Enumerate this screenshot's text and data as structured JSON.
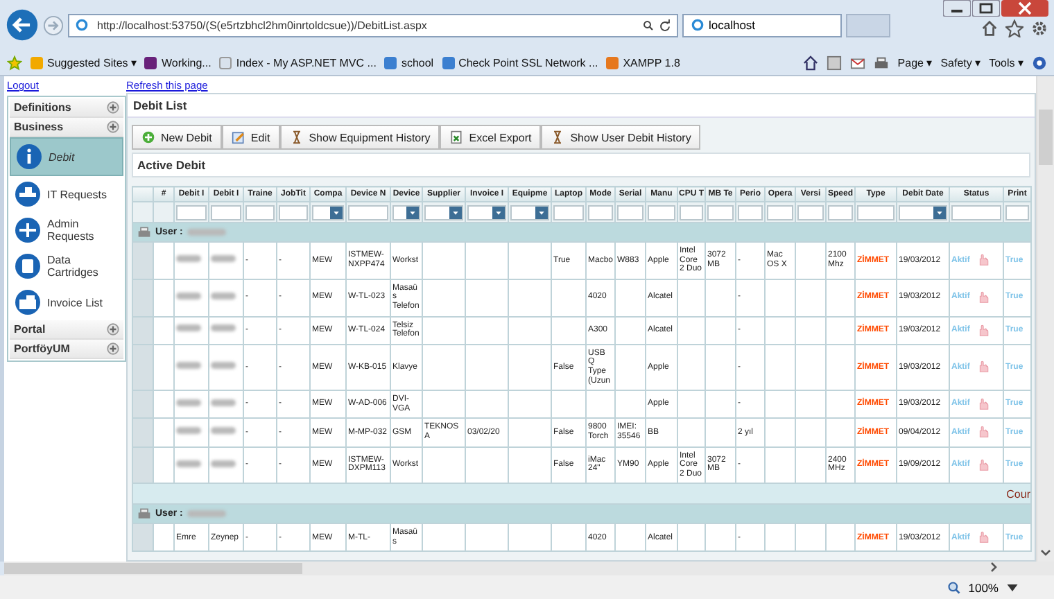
{
  "browser": {
    "address": "http://localhost:53750/(S(e5rtzbhcl2hm0inrtoldcsue))/DebitList.aspx",
    "tabs": [
      {
        "label": "localhost",
        "selected": true
      }
    ],
    "favorites": [
      "Suggested Sites ▾",
      "Working...",
      "Index - My ASP.NET MVC ...",
      "school",
      "Check Point SSL Network ...",
      "XAMPP 1.8"
    ],
    "commands": [
      "Page ▾",
      "Safety ▾",
      "Tools ▾"
    ],
    "zoom": "100%"
  },
  "page": {
    "logout": "Logout",
    "refresh": "Refresh this page",
    "title": "Debit List",
    "subtitle": "Active Debit",
    "sidebar": [
      {
        "label": "Definitions"
      },
      {
        "label": "Business",
        "items": [
          {
            "label": "Debit",
            "selected": true
          },
          {
            "label": "IT Requests",
            "selected": false
          },
          {
            "label": "Admin Requests",
            "selected": false
          },
          {
            "label": "Data Cartridges",
            "selected": false
          },
          {
            "label": "Invoice List",
            "selected": false
          }
        ]
      },
      {
        "label": "Portal"
      },
      {
        "label": "PortföyUM"
      }
    ],
    "toolbar": [
      "New Debit",
      "Edit",
      "Show Equipment History",
      "Excel Export",
      "Show User Debit History"
    ]
  },
  "table": {
    "columns": [
      {
        "label": "#",
        "filterable": false,
        "kind": "plain"
      },
      {
        "label": "Debit I",
        "filterable": true,
        "dropdown": false,
        "kind": "plain"
      },
      {
        "label": "Debit I",
        "filterable": true,
        "dropdown": false,
        "kind": "plain"
      },
      {
        "label": "Traine",
        "filterable": true,
        "dropdown": false,
        "kind": "plain"
      },
      {
        "label": "JobTit",
        "filterable": true,
        "dropdown": false,
        "kind": "plain"
      },
      {
        "label": "Compa",
        "filterable": true,
        "dropdown": true,
        "kind": "plain"
      },
      {
        "label": "Device N",
        "filterable": true,
        "dropdown": false,
        "kind": "plain"
      },
      {
        "label": "Device",
        "filterable": true,
        "dropdown": true,
        "kind": "plain"
      },
      {
        "label": "Supplier",
        "filterable": true,
        "dropdown": true,
        "kind": "plain"
      },
      {
        "label": "Invoice I",
        "filterable": true,
        "dropdown": true,
        "kind": "plain"
      },
      {
        "label": "Equipme",
        "filterable": true,
        "dropdown": true,
        "kind": "plain"
      },
      {
        "label": "Laptop",
        "filterable": true,
        "dropdown": false,
        "kind": "plain"
      },
      {
        "label": "Mode",
        "filterable": true,
        "dropdown": false,
        "kind": "plain"
      },
      {
        "label": "Serial",
        "filterable": true,
        "dropdown": false,
        "kind": "plain"
      },
      {
        "label": "Manu",
        "filterable": true,
        "dropdown": false,
        "kind": "plain"
      },
      {
        "label": "CPU T",
        "filterable": true,
        "dropdown": false,
        "kind": "plain"
      },
      {
        "label": "MB Te",
        "filterable": true,
        "dropdown": false,
        "kind": "plain"
      },
      {
        "label": "Perio",
        "filterable": true,
        "dropdown": false,
        "kind": "plain"
      },
      {
        "label": "Opera",
        "filterable": true,
        "dropdown": false,
        "kind": "plain"
      },
      {
        "label": "Versi",
        "filterable": true,
        "dropdown": false,
        "kind": "plain"
      },
      {
        "label": "Speed",
        "filterable": true,
        "dropdown": false,
        "kind": "plain"
      },
      {
        "label": "Type",
        "filterable": true,
        "dropdown": false,
        "kind": "type"
      },
      {
        "label": "Debit Date",
        "filterable": true,
        "dropdown": true,
        "kind": "plain"
      },
      {
        "label": "Status",
        "filterable": true,
        "dropdown": false,
        "kind": "status"
      },
      {
        "label": "Print",
        "filterable": true,
        "dropdown": false,
        "kind": "link"
      }
    ],
    "groups": [
      {
        "label": "User :",
        "footer": "Cour",
        "rows": [
          {
            "cells": [
              null,
              {
                "kind": "blurred"
              },
              {
                "kind": "blurred"
              },
              "-",
              "-",
              "MEW",
              "ISTMEW-NXPP474",
              "Workst",
              null,
              null,
              null,
              "True",
              "Macbo",
              "W883",
              "Apple",
              "Intel Core 2 Duo",
              "3072 MB",
              "-",
              "Mac OS X",
              null,
              "2100 Mhz",
              "ZİMMET",
              "19/03/2012",
              "Aktif",
              "True"
            ]
          },
          {
            "cells": [
              null,
              {
                "kind": "blurred"
              },
              {
                "kind": "blurred"
              },
              "-",
              "-",
              "MEW",
              "W-TL-023",
              "Masaüs Telefon",
              null,
              null,
              null,
              null,
              "4020",
              null,
              "Alcatel",
              null,
              null,
              "-",
              null,
              null,
              null,
              "ZİMMET",
              "19/03/2012",
              "Aktif",
              "True"
            ]
          },
          {
            "cells": [
              null,
              {
                "kind": "blurred"
              },
              {
                "kind": "blurred"
              },
              "-",
              "-",
              "MEW",
              "W-TL-024",
              "Telsiz Telefon",
              null,
              null,
              null,
              null,
              "A300",
              null,
              "Alcatel",
              null,
              null,
              "-",
              null,
              null,
              null,
              "ZİMMET",
              "19/03/2012",
              "Aktif",
              "True"
            ]
          },
          {
            "cells": [
              null,
              {
                "kind": "blurred"
              },
              {
                "kind": "blurred"
              },
              "-",
              "-",
              "MEW",
              "W-KB-015",
              "Klavye",
              null,
              null,
              null,
              "False",
              "USB Q Type (Uzun",
              null,
              "Apple",
              null,
              null,
              "-",
              null,
              null,
              null,
              "ZİMMET",
              "19/03/2012",
              "Aktif",
              "True"
            ]
          },
          {
            "cells": [
              null,
              {
                "kind": "blurred"
              },
              {
                "kind": "blurred"
              },
              "-",
              "-",
              "MEW",
              "W-AD-006",
              "DVI-VGA",
              null,
              null,
              null,
              null,
              null,
              null,
              "Apple",
              null,
              null,
              "-",
              null,
              null,
              null,
              "ZİMMET",
              "19/03/2012",
              "Aktif",
              "True"
            ]
          },
          {
            "cells": [
              null,
              {
                "kind": "blurred"
              },
              {
                "kind": "blurred"
              },
              "-",
              "-",
              "MEW",
              "M-MP-032",
              "GSM",
              "TEKNOSA",
              "03/02/20",
              null,
              "False",
              "9800 Torch",
              "IMEI: 35546",
              "BB",
              null,
              null,
              "2 yıl",
              null,
              null,
              null,
              "ZİMMET",
              "09/04/2012",
              "Aktif",
              "True"
            ]
          },
          {
            "cells": [
              null,
              {
                "kind": "blurred"
              },
              {
                "kind": "blurred"
              },
              "-",
              "-",
              "MEW",
              "ISTMEW-DXPM113",
              "Workst",
              null,
              null,
              null,
              "False",
              "iMac 24\"",
              "YM90",
              "Apple",
              "Intel Core 2 Duo",
              "3072 MB",
              "-",
              null,
              null,
              "2400 MHz",
              "ZİMMET",
              "19/09/2012",
              "Aktif",
              "True"
            ]
          }
        ]
      },
      {
        "label": "User :",
        "rows": [
          {
            "cells": [
              null,
              "Emre",
              "Zeynep",
              "-",
              "-",
              "MEW",
              "M-TL-",
              "Masaüs",
              null,
              null,
              null,
              null,
              "4020",
              null,
              "Alcatel",
              null,
              null,
              "-",
              null,
              null,
              null,
              "ZİMMET",
              "19/03/2012",
              "Aktif",
              "True"
            ]
          }
        ]
      }
    ]
  }
}
